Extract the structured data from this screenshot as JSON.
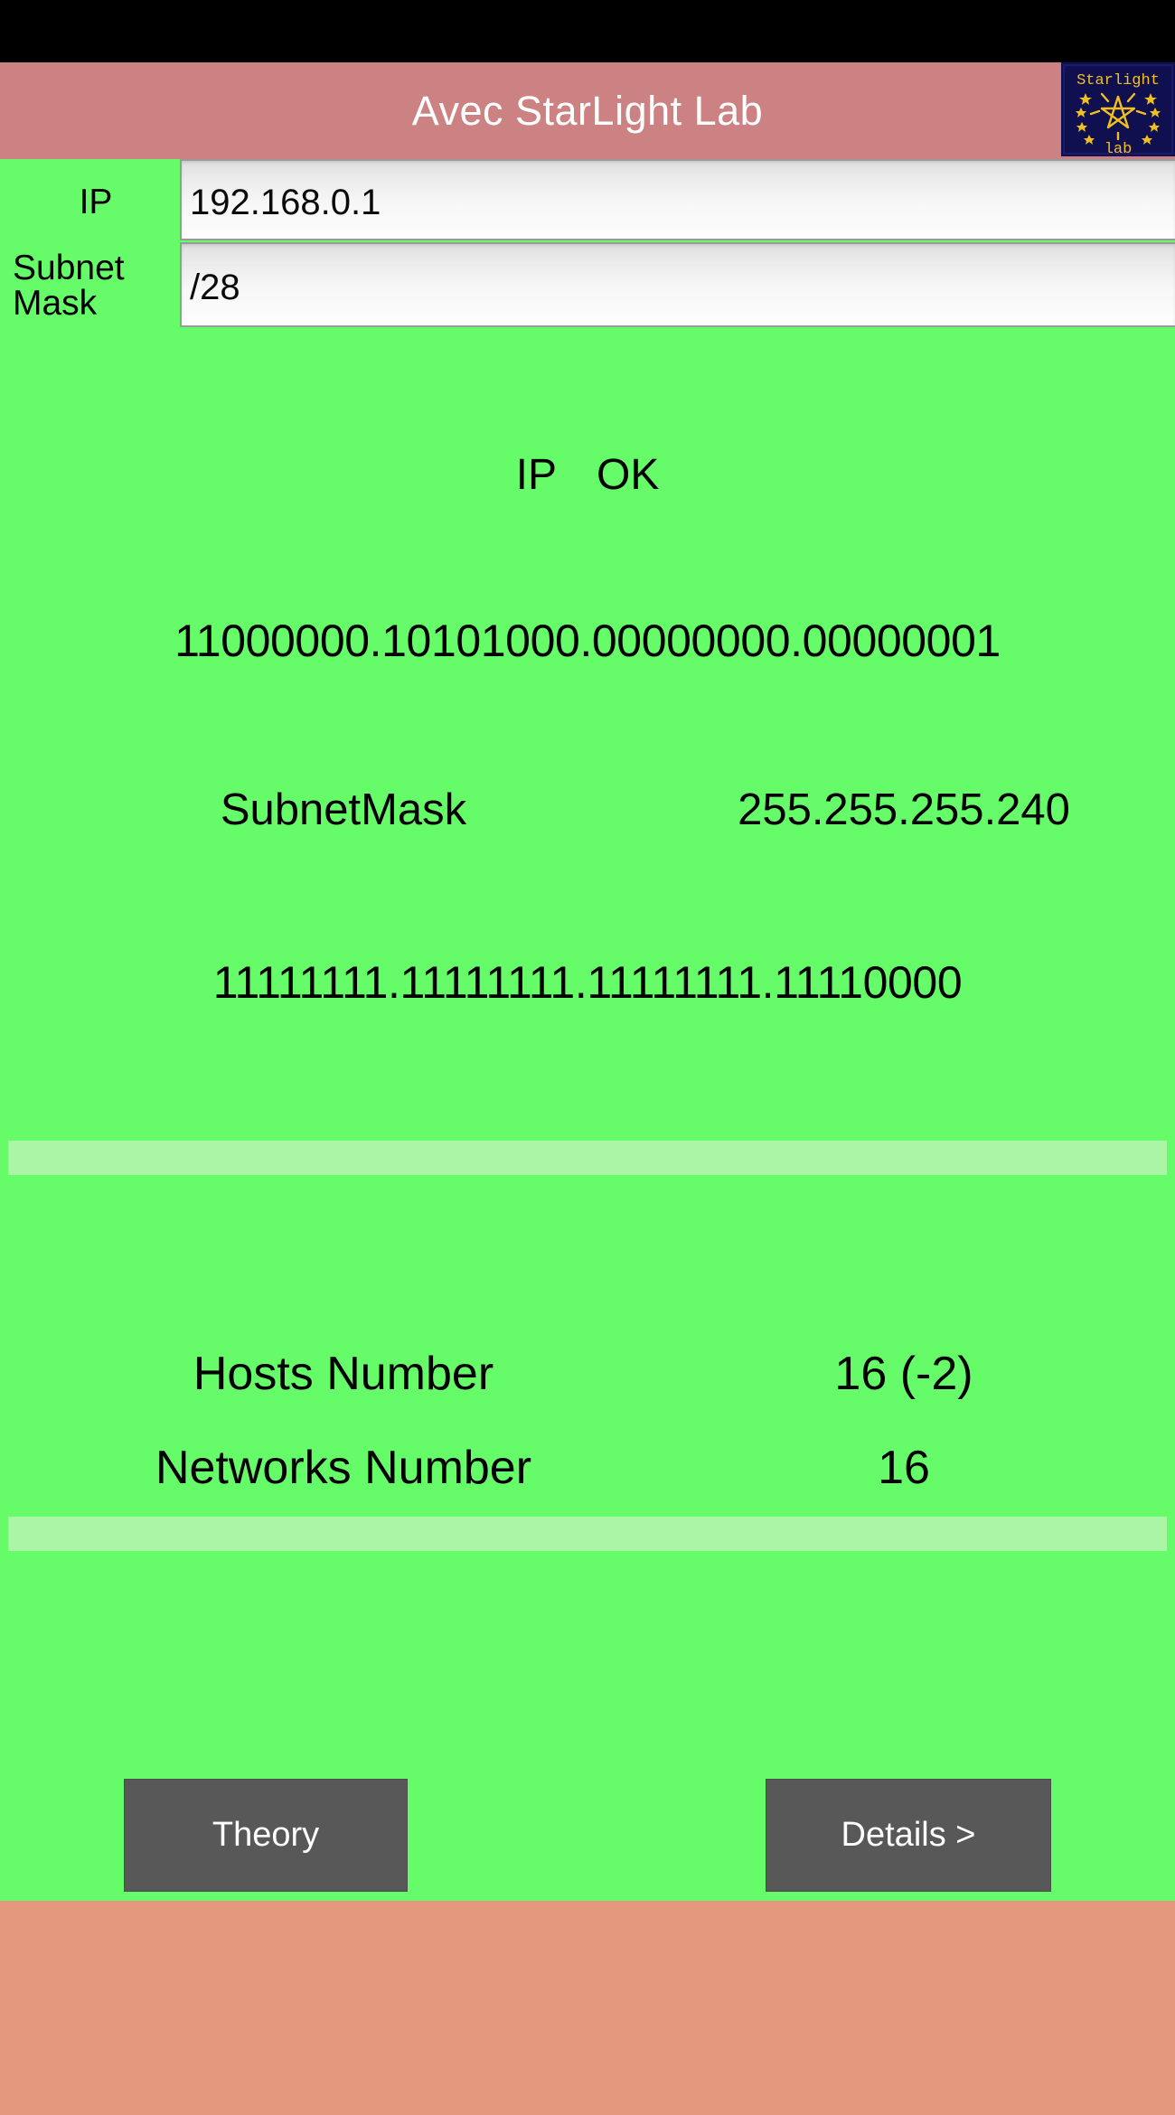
{
  "app": {
    "title": "Avec StarLight Lab",
    "logo_top_text": "Starlight",
    "logo_bottom_text": "lab",
    "logo_icon": "star-logo-icon"
  },
  "colors": {
    "title_bar": "#cc8183",
    "body_green": "#66fb69",
    "divider_green": "#aaf5a6",
    "button_gray": "#585858",
    "bottom_bar": "#e4987e",
    "logo_navy": "#101050",
    "logo_yellow": "#f2c01e",
    "status_bar": "#000000"
  },
  "form": {
    "ip": {
      "label": "IP",
      "value": "192.168.0.1",
      "placeholder": "192.168.0.1"
    },
    "subnet_mask": {
      "label_line1": "Subnet",
      "label_line2": "Mask",
      "value": "/28",
      "placeholder": "/28"
    }
  },
  "results": {
    "ip_status_label": "IP",
    "ip_status_value": "OK",
    "ip_binary": "11000000.10101000.00000000.00000001",
    "subnetmask_label": "SubnetMask",
    "subnetmask_value": "255.255.255.240",
    "subnetmask_binary": "11111111.11111111.11111111.11110000",
    "hosts_label": "Hosts Number",
    "hosts_value": "16 (-2)",
    "networks_label": "Networks Number",
    "networks_value": "16"
  },
  "buttons": {
    "theory": "Theory",
    "details": "Details >"
  }
}
